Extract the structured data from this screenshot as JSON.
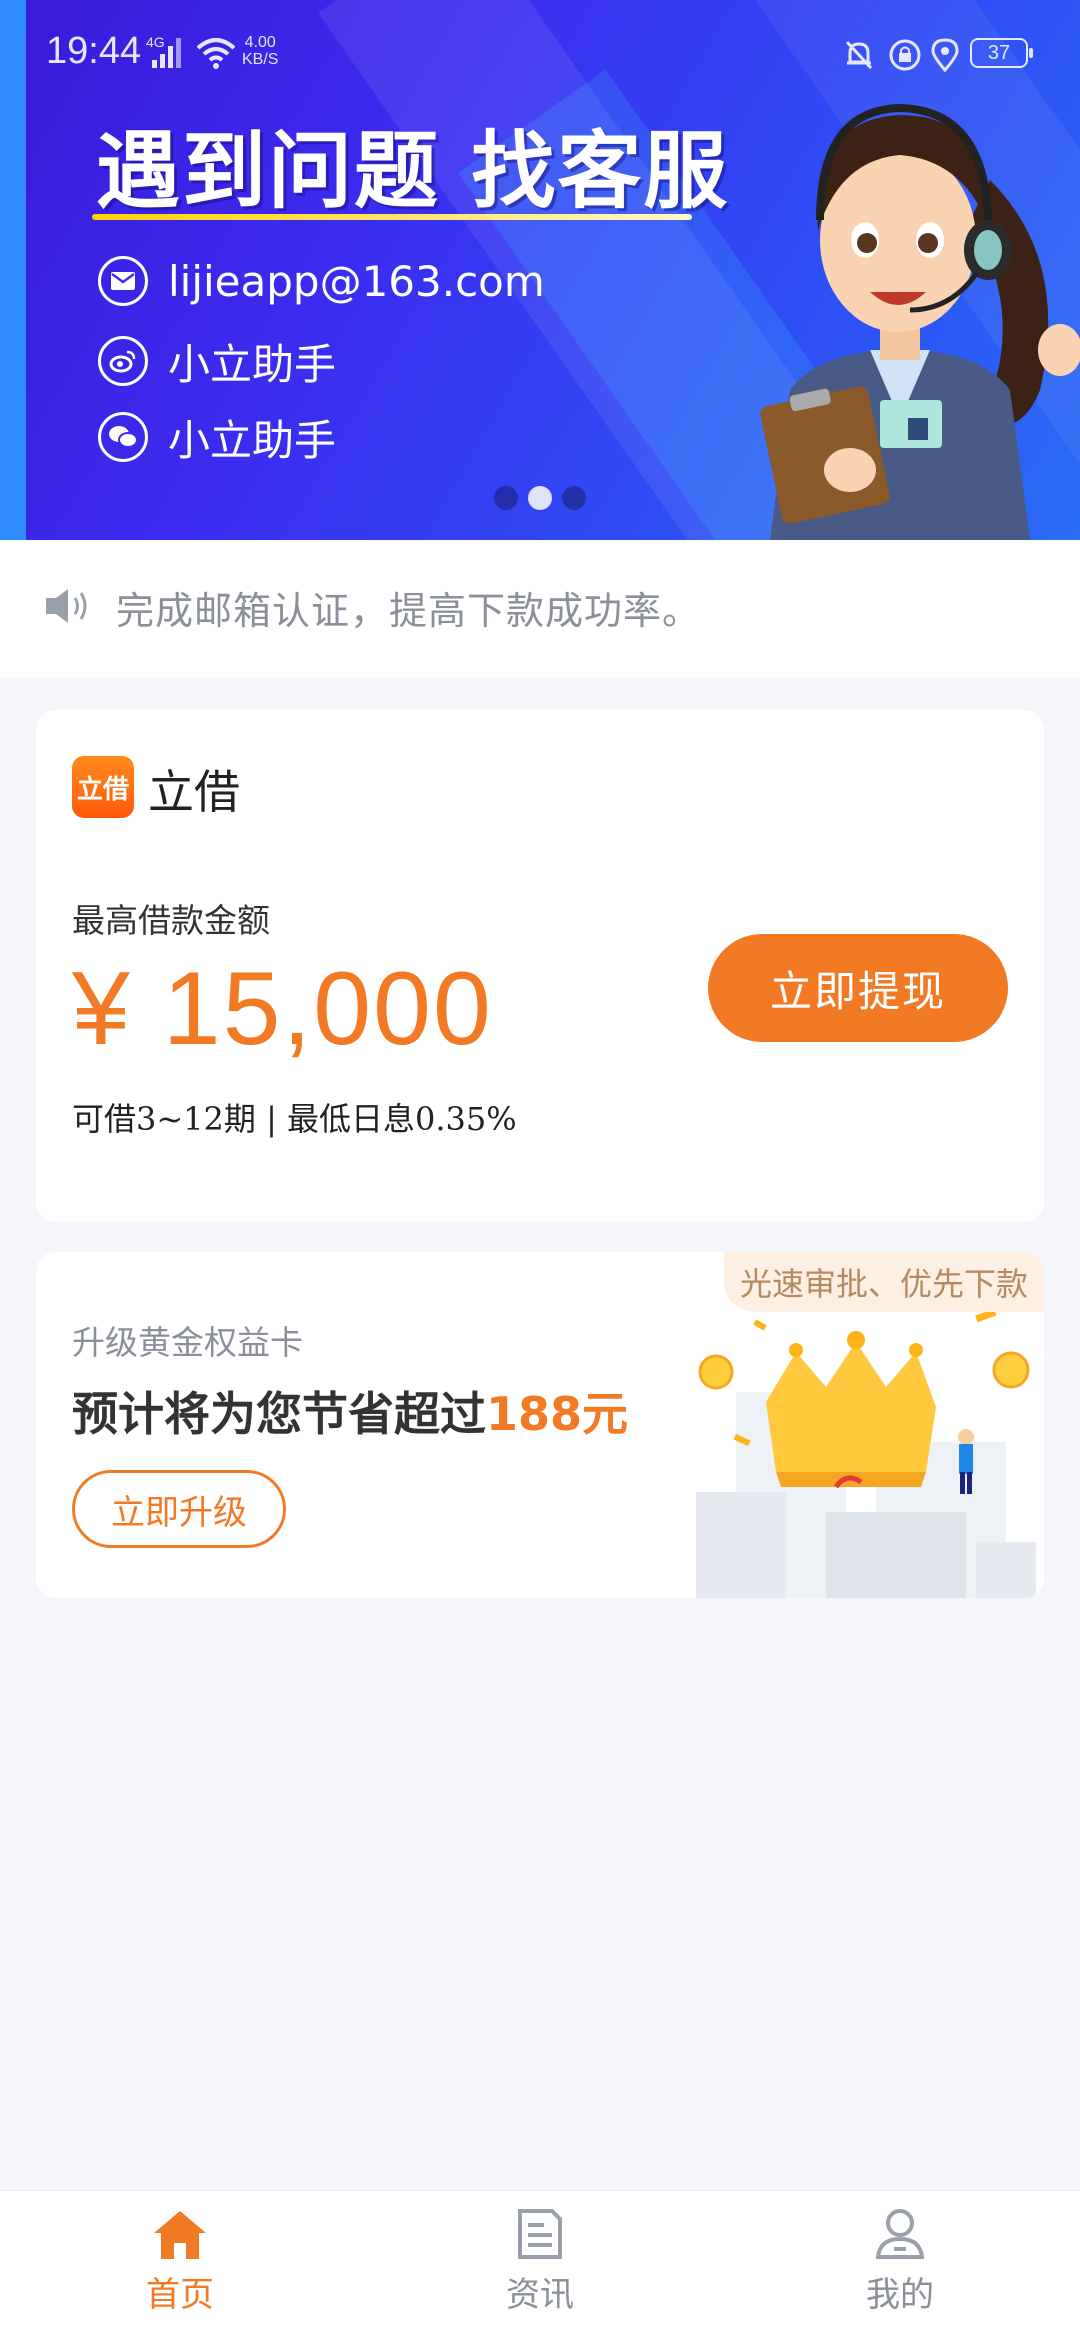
{
  "status_bar": {
    "time": "19:44",
    "network": "4G",
    "speed_value": "4.00",
    "speed_unit": "KB/S",
    "battery": "37"
  },
  "banner": {
    "title": "遇到问题 找客服",
    "contacts": [
      {
        "icon": "mail-icon",
        "text": "lijieapp@163.com"
      },
      {
        "icon": "weibo-icon",
        "text": "小立助手"
      },
      {
        "icon": "wechat-icon",
        "text": "小立助手"
      }
    ],
    "active_slide": 2,
    "slide_count": 3
  },
  "notice": {
    "text": "完成邮箱认证，提高下款成功率。"
  },
  "loan_card": {
    "logo_text": "立借",
    "brand_name": "立借",
    "max_label": "最高借款金额",
    "amount": "¥ 15,000",
    "terms": "可借3~12期 | 最低日息0.35%",
    "withdraw_label": "立即提现"
  },
  "upgrade_card": {
    "tag": "光速审批、优先下款",
    "label": "升级黄金权益卡",
    "desc_prefix": "预计将为您节省超过",
    "desc_highlight": "188元",
    "button_label": "立即升级"
  },
  "bottom_nav": {
    "items": [
      {
        "label": "首页",
        "icon": "home-icon",
        "active": true
      },
      {
        "label": "资讯",
        "icon": "news-icon",
        "active": false
      },
      {
        "label": "我的",
        "icon": "user-icon",
        "active": false
      }
    ]
  },
  "colors": {
    "accent": "#f27a24",
    "banner_blue": "#3b2cf0",
    "background": "#f4f6fa",
    "muted_text": "#8a8f99"
  }
}
